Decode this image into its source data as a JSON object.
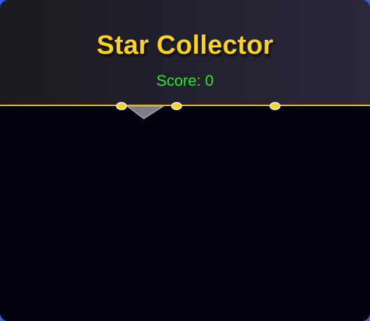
{
  "game": {
    "title": "Star Collector",
    "score_text": "Score: 0"
  },
  "colors": {
    "title": "#ffd21a",
    "score": "#2ee62e",
    "accent_line": "#f4c20d",
    "playfield": "#02020e",
    "star": "#ffd21a",
    "player": "#7d7d85"
  },
  "icons": {
    "player": "player-ship-icon",
    "star": "star-icon"
  }
}
